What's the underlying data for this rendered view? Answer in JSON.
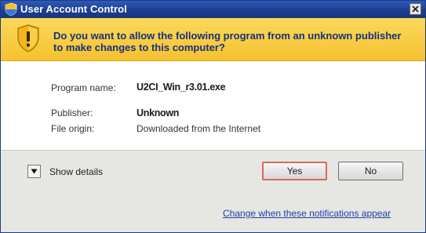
{
  "window": {
    "title": "User Account Control",
    "close_label": "×"
  },
  "banner": {
    "question": "Do you want to allow the following program from an unknown publisher to make changes to this computer?",
    "icon": "uac-shield-warning-icon"
  },
  "details": {
    "program_name_label": "Program name:",
    "program_name_value": "U2CI_Win_r3.01.exe",
    "publisher_label": "Publisher:",
    "publisher_value": "Unknown",
    "file_origin_label": "File origin:",
    "file_origin_value": "Downloaded from the Internet"
  },
  "footer": {
    "show_details_label": "Show details",
    "yes_label": "Yes",
    "no_label": "No",
    "settings_link": "Change when these notifications appear"
  },
  "colors": {
    "titlebar": "#1d3f94",
    "banner": "#f5c22f",
    "banner_text": "#15307f",
    "link": "#1f3fa6",
    "yes_focus_border": "#d66a5c"
  }
}
